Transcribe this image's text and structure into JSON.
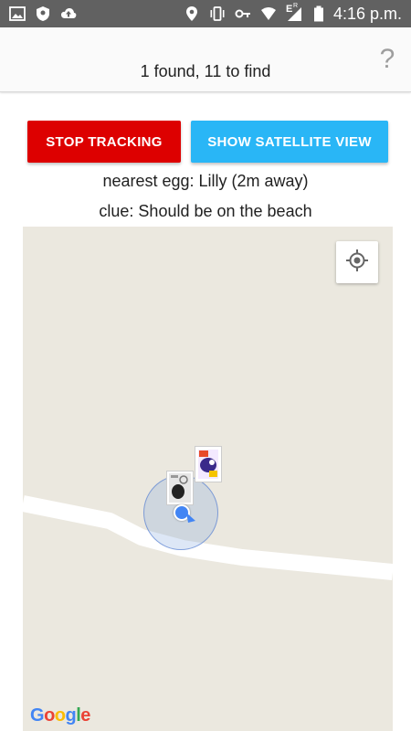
{
  "status_bar": {
    "time": "4:16 p.m.",
    "left_icons": [
      "image-icon",
      "shield-icon",
      "cloud-upload-icon"
    ],
    "right_icons": [
      "location-icon",
      "vibrate-icon",
      "key-icon",
      "wifi-icon",
      "signal-icon",
      "battery-icon"
    ],
    "signal_label": "E",
    "signal_sub": "R"
  },
  "app_bar": {
    "title": "1 found, 11 to find",
    "help_symbol": "?"
  },
  "buttons": {
    "stop_tracking": "STOP TRACKING",
    "show_satellite": "SHOW SATELLITE VIEW"
  },
  "info": {
    "nearest": "nearest egg: Lilly (2m away)",
    "clue": "clue: Should be on the beach"
  },
  "map": {
    "attribution": [
      "G",
      "o",
      "o",
      "g",
      "l",
      "e"
    ]
  },
  "colors": {
    "stop_button": "#dd0000",
    "satellite_button": "#29b6f6",
    "map_background": "#ebe8df",
    "user_location": "#4285f4"
  }
}
